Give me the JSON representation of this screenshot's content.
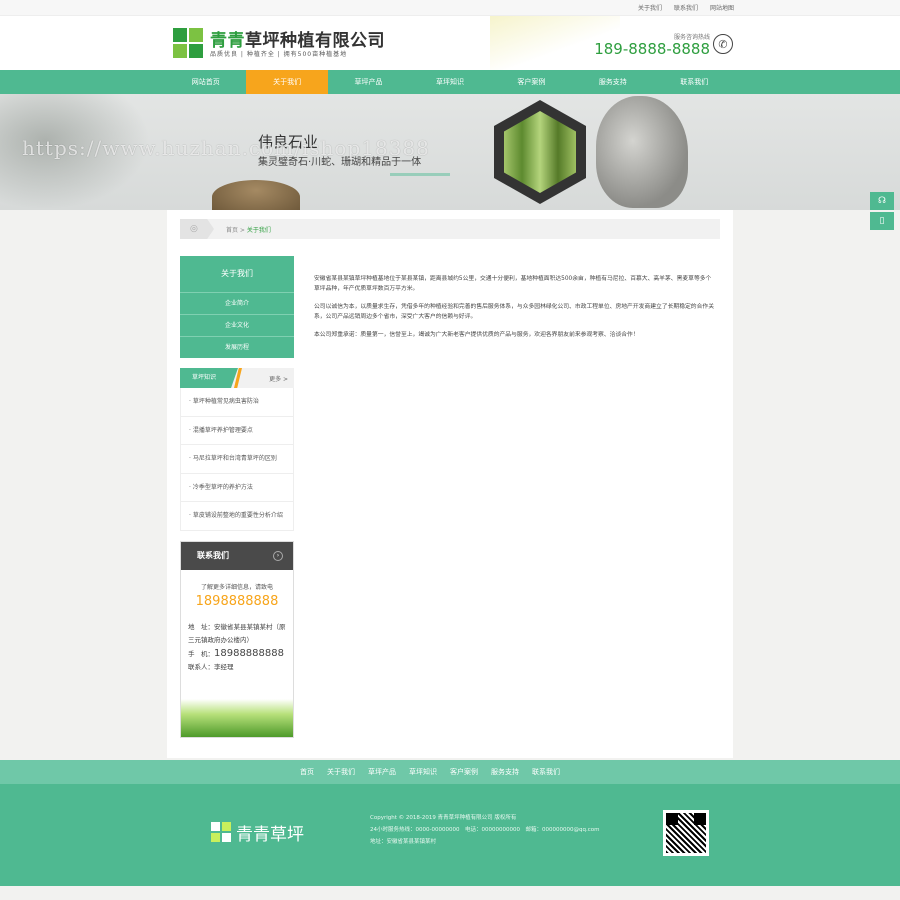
{
  "topbar": {
    "links": [
      "关于我们",
      "联系我们",
      "网站地图"
    ]
  },
  "header": {
    "company_green": "青青",
    "company_rest": "草坪种植有限公司",
    "slogan": "品质优良 | 种植齐全 | 拥有500亩种植基地",
    "hotline_label": "服务咨询热线",
    "hotline": "189-8888-8888",
    "phone_icon": "phone-icon"
  },
  "nav": {
    "items": [
      "网站首页",
      "关于我们",
      "草坪产品",
      "草坪知识",
      "客户案例",
      "服务支持",
      "联系我们"
    ],
    "active_index": 1
  },
  "banner": {
    "title": "伟良石业",
    "subtitle": "集灵璧奇石·川蛇、珊瑚和精品于一体",
    "watermark": "https://www.huzhan.com/ishop18388"
  },
  "breadcrumb": {
    "home": "首页",
    "sep": " > ",
    "current": "关于我们"
  },
  "sidebar": {
    "title": "关于我们",
    "items": [
      "企业简介",
      "企业文化",
      "发展历程"
    ]
  },
  "news": {
    "title": "草坪知识",
    "more": "更多 >",
    "items": [
      "· 草坪种植常见病虫害防治",
      "· 混播草坪养护管理要点",
      "· 马尼拉草坪和台湾青草坪的区别",
      "· 冷季型草坪的养护方法",
      "· 草皮铺设前整地的重要性分析介绍"
    ]
  },
  "contact": {
    "title": "联系我们",
    "intro": "了解更多详细信息，请致电",
    "phone": "1898888888",
    "address_label": "地　址：",
    "address": "安徽省某县某镇某村（原三元镇政府办公楼内）",
    "tel_label": "手　机：",
    "tel": "18988888888",
    "person_label": "联系人：",
    "person": "李经理"
  },
  "article": {
    "p1": "安徽省某县某镇草坪种植基地位于某县某镇，距离县城约5公里，交通十分便利，基地种植面积达500余亩，种植有马尼拉、百慕大、高羊茅、黑麦草等多个草坪品种，年产优质草坪数百万平方米。",
    "p2": "公司以诚信为本，以质量求生存，凭借多年的种植经验和完善的售后服务体系，与众多园林绿化公司、市政工程单位、房地产开发商建立了长期稳定的合作关系，公司产品远销周边多个省市，深受广大客户的信赖与好评。",
    "p3": "本公司郑重承诺：质量第一，信誉至上，竭诚为广大新老客户提供优质的产品与服务，欢迎各界朋友前来参观考察、洽谈合作！"
  },
  "footer": {
    "links": [
      "首页",
      "关于我们",
      "草坪产品",
      "草坪知识",
      "客户案例",
      "服务支持",
      "联系我们"
    ],
    "logo_text": "青青草坪",
    "copyright": "Copyright © 2018-2019 青青草坪种植有限公司 版权所有",
    "contact_line": "24小时服务热线：0000-00000000　电话：00000000000　邮箱：000000000@qq.com",
    "address_line": "地址：安徽省某县某镇某村"
  },
  "side_tools": [
    "headset-icon",
    "mobile-icon"
  ],
  "colors": {
    "brand_green": "#4fb991",
    "accent_orange": "#f7a51c",
    "logo_green": "#2e9e3f"
  }
}
